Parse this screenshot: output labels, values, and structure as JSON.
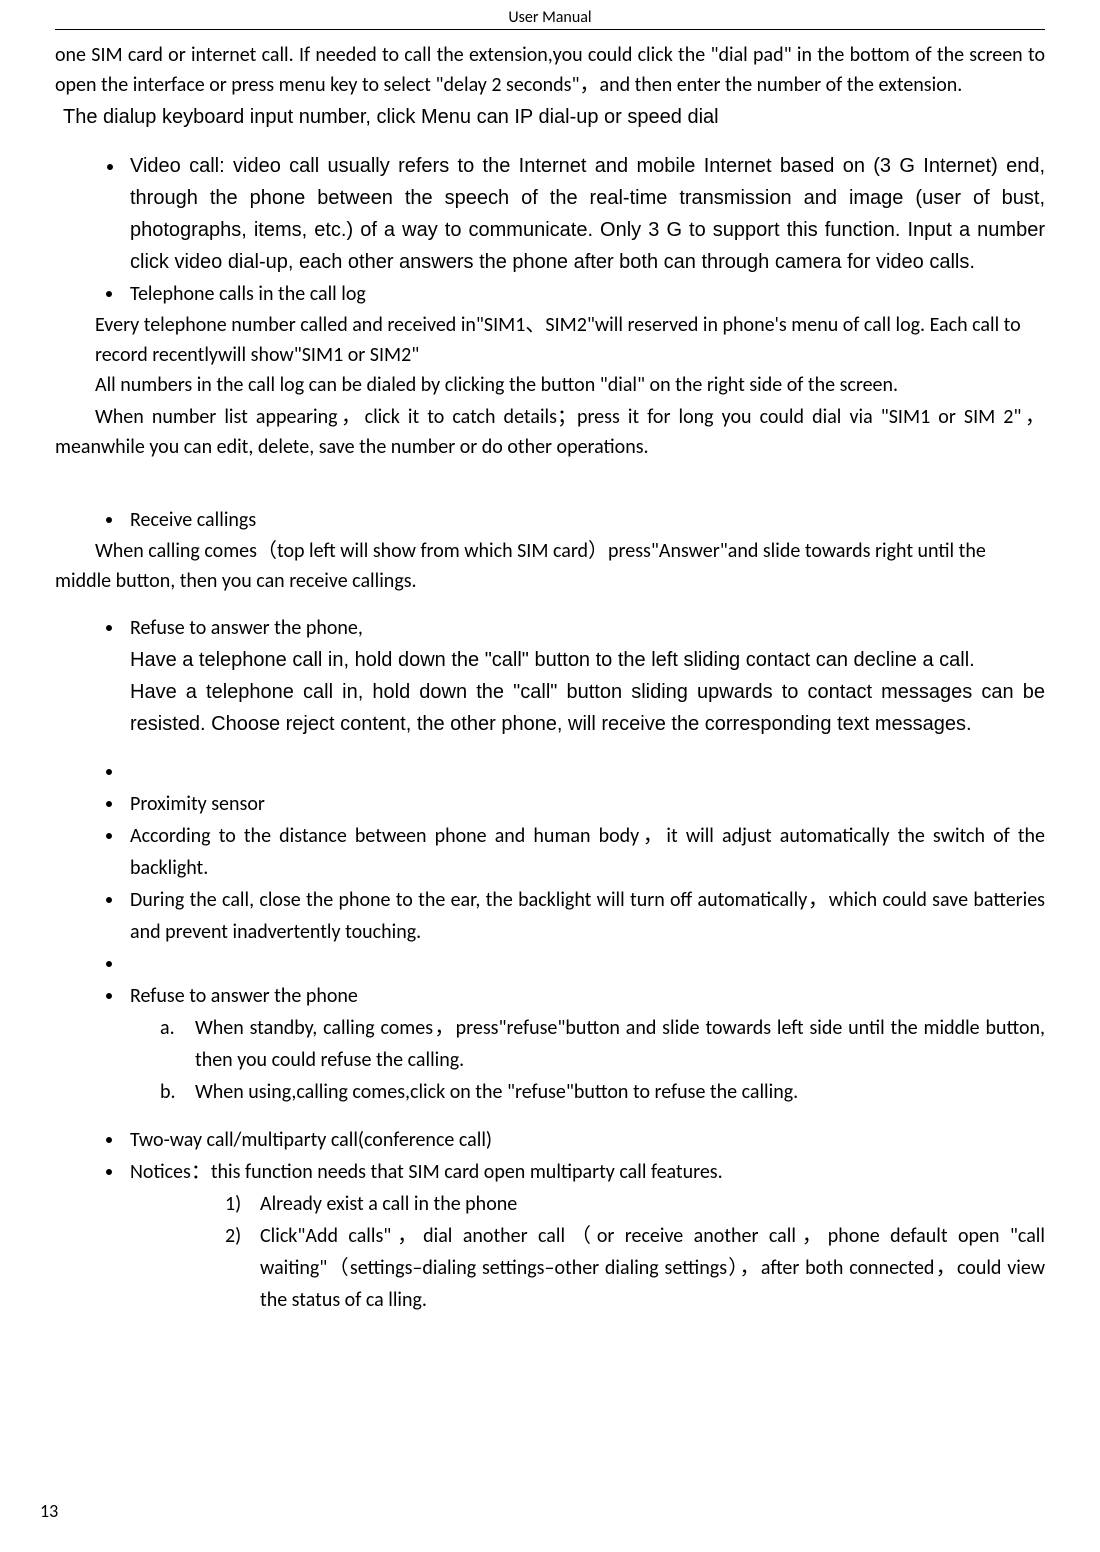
{
  "header": "User    Manual",
  "page": "13",
  "p1": "one SIM card or internet call. If needed to call the extension,you could click the \"dial pad\" in the bottom of the screen to open the interface or press menu key to select \"delay 2 seconds\"，and then enter the number of the extension.",
  "p2": "The dialup keyboard input number, click Menu can IP dial-up or speed dial",
  "b1": "Video call: video call usually refers to the Internet and mobile Internet based on (3 G Internet) end, through the phone between the speech of the real-time transmission and image (user of bust, photographs, items, etc.) of a way to communicate. Only 3 G to support this function. Input a number click video dial-up, each other answers the phone after both can through camera for video calls.",
  "b2": "Telephone calls in the call log",
  "p3": "Every telephone number called and received in\"SIM1、SIM2\"will reserved in phone's menu of call log. Each call to record recentlywill show\"SIM1 or SIM2\"",
  "p4": "All numbers in the call log can be dialed by clicking the button \"dial\" on the right side of the screen.",
  "p5": "When number list appearing，click it to catch details；press it for long you could dial via \"SIM1 or SIM 2\"，meanwhile you can edit, delete, save the number or do other operations.",
  "b3": "Receive callings",
  "p6": "When calling comes（top left will show from which SIM card）press\"Answer\"and slide towards right until the middle button, then you can receive callings.",
  "b4": "Refuse to answer the phone,",
  "b4a": "Have a telephone call in, hold down the \"call\" button to the left sliding contact can decline a call.",
  "b4b": "Have a telephone call in, hold down the \"call\" button sliding upwards to contact messages can be resisted. Choose reject content, the other phone, will receive the corresponding text messages.",
  "b5": " ",
  "b6": "Proximity sensor",
  "b7": "According to the distance between phone and human body，it will adjust automatically the switch of the backlight.",
  "b8": "During the call, close the phone to the ear, the backlight will turn off automatically，which could save batteries and prevent inadvertently touching.",
  "b9": " ",
  "b10": "Refuse to answer the phone",
  "la_marker": "a.",
  "la": "When standby, calling comes，press\"refuse\"button and slide towards left side until the middle button, then you could refuse the calling.",
  "lb_marker": "b.",
  "lb": "When using,calling comes,click on the \"refuse\"button to refuse the calling.",
  "b11": "Two-way call/multiparty call(conference call)",
  "b12": "Notices：this function needs that SIM card open multiparty call features.",
  "n1_marker": "1)",
  "n1": "Already exist a call in the phone",
  "n2_marker": "2)",
  "n2": "Click\"Add calls\"，dial another call（or receive another call，phone default open \"call waiting\"（settings–dialing settings–other dialing settings），after both connected，could view the status of ca    lling."
}
